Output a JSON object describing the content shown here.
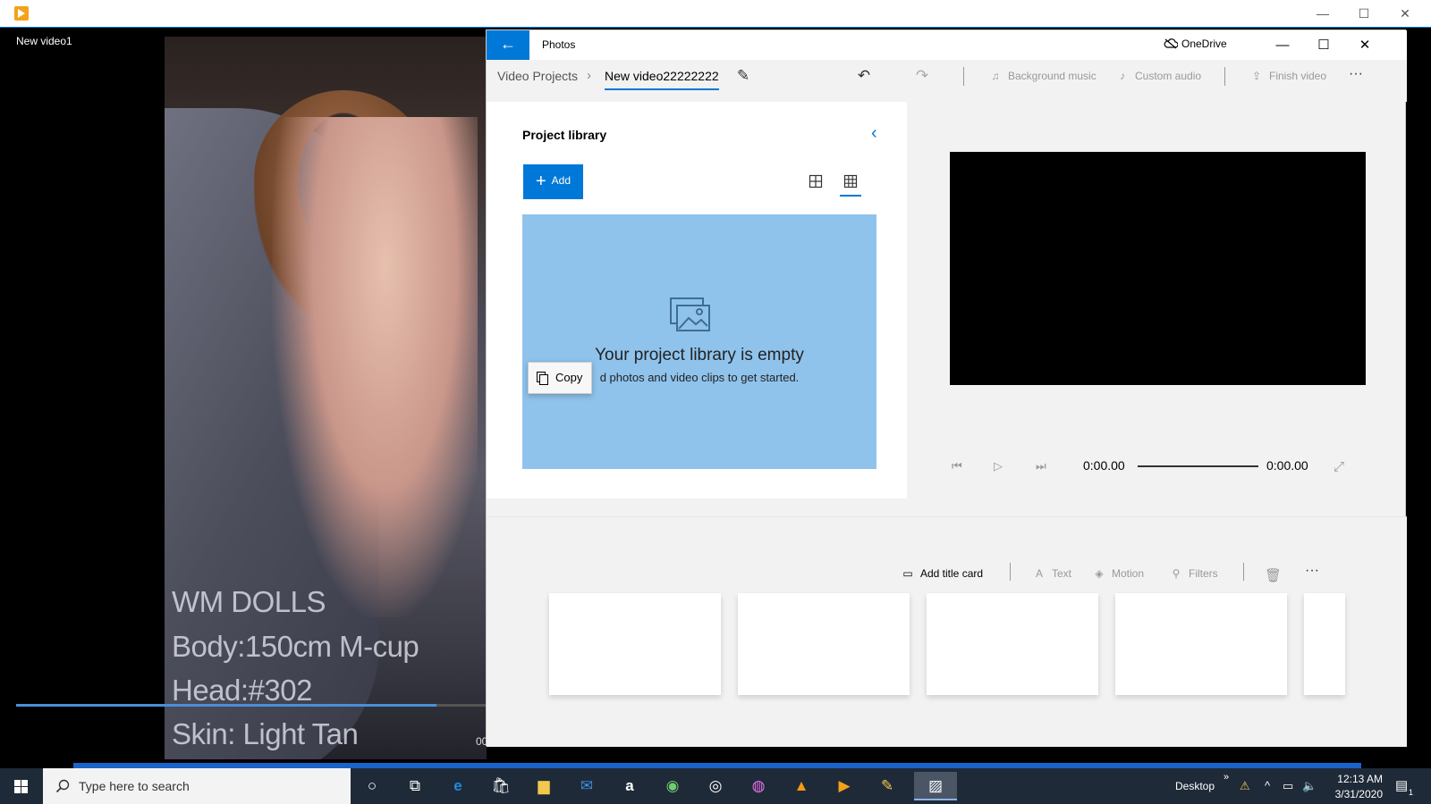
{
  "background_window": {
    "title": "New video1",
    "video_overlay_lines": [
      "WM DOLLS",
      "Body:150cm M-cup",
      "Head:#302",
      "Skin: Light Tan"
    ],
    "time_fragment": "00"
  },
  "photos": {
    "app_title": "Photos",
    "onedrive_label": "OneDrive",
    "breadcrumb": {
      "root": "Video Projects",
      "current": "New video22222222"
    },
    "commands": {
      "background_music": "Background music",
      "custom_audio": "Custom audio",
      "finish_video": "Finish video",
      "more": "···"
    },
    "library": {
      "title": "Project library",
      "add_label": "Add",
      "empty_title": "Your project library is empty",
      "empty_subtitle": "d photos and video clips to get started."
    },
    "copy_tooltip": "Copy",
    "player": {
      "time_start": "0:00.00",
      "time_end": "0:00.00"
    },
    "storyboard": {
      "add_title_card": "Add title card",
      "text": "Text",
      "motion": "Motion",
      "filters": "Filters",
      "more": "···",
      "card_count": 5
    }
  },
  "taskbar": {
    "search_placeholder": "Type here to search",
    "desktop_label": "Desktop",
    "clock_time": "12:13 AM",
    "clock_date": "3/31/2020",
    "notification_count": "1"
  },
  "colors": {
    "accent": "#0078d7",
    "empty_library_bg": "#8fc3ec",
    "taskbar": "#1f2a38"
  }
}
